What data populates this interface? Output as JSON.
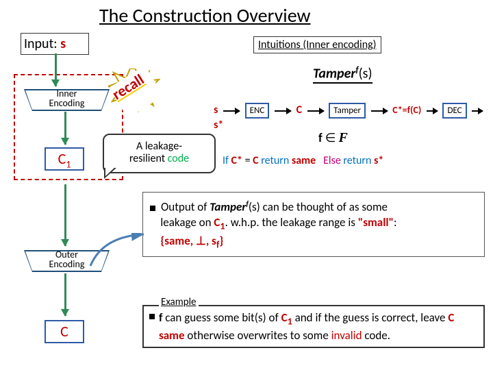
{
  "title": "The Construction Overview",
  "input": {
    "label": "Input: ",
    "var": "s"
  },
  "intuitions": "Intuitions (Inner encoding)",
  "flow": {
    "inner_enc": "Inner\nEncoding",
    "c1": "C",
    "c1_sub": "1",
    "outer_enc": "Outer\nEncoding",
    "c": "C"
  },
  "recall": "recall",
  "speech": {
    "line1": "A leakage-",
    "line2_pre": "resilient ",
    "line2_code": "code"
  },
  "tamper_formula": {
    "name": "Tamper",
    "sup": "f",
    "arg": "(s)"
  },
  "pipeline": {
    "s": "s",
    "enc": "ENC",
    "c": "C",
    "tamper": "Tamper",
    "cstar": "C*=f(C)",
    "dec": "DEC",
    "sstar": "s*"
  },
  "f_in": {
    "f": "f",
    "in": " ∈ ",
    "F": "F"
  },
  "return_line": {
    "if": "If ",
    "cstar": "C*",
    "eq": " = ",
    "c": "C",
    "ret": " return ",
    "same": "same",
    "sp": "   ",
    "else": "Else ",
    "ret2": "return ",
    "sstar": "s*"
  },
  "output": {
    "line1_pre": "Output of ",
    "tamper": "Tamper",
    "sup": "f",
    "arg": "(s)",
    "line1_post": " can be thought of as some",
    "line2_pre": "leakage on ",
    "c1": "C",
    "c1_sub": "1",
    "line2_post": ".  w.h.p. the leakage range is ",
    "small": "\"small\"",
    "colon": ":",
    "set": "{same, ⊥, s",
    "set_sub": "f",
    "set_close": "}"
  },
  "example_label": "Example ",
  "example": {
    "pre": "f",
    "text1": " can guess some bit(s) of  ",
    "c1": "C",
    "c1_sub": "1",
    "text2": " and if the guess is correct, leave ",
    "c": "C",
    "same": " same",
    "text3": " otherwise overwrites to some ",
    "invalid": "invalid",
    "text4": " code."
  }
}
